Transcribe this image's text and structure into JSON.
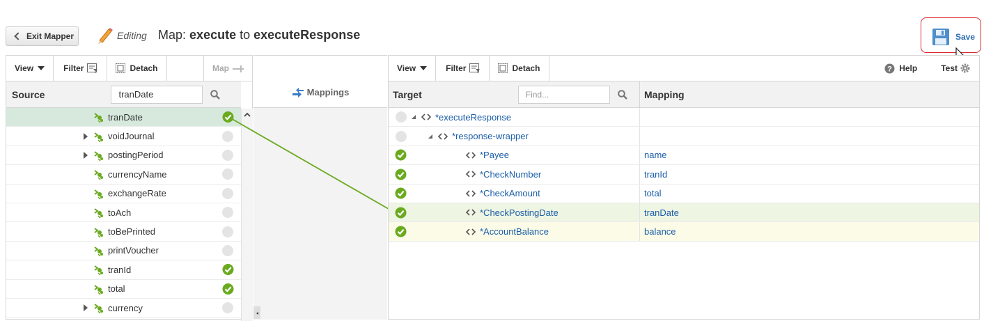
{
  "header": {
    "exit_label": "Exit Mapper",
    "editing_label": "Editing",
    "map_prefix": "Map:",
    "map_source": "execute",
    "map_to": "to",
    "map_target": "executeResponse",
    "save_label": "Save"
  },
  "source_panel": {
    "toolbar": {
      "view": "View",
      "filter": "Filter",
      "detach": "Detach",
      "map": "Map"
    },
    "header_title": "Source",
    "search_value": "tranDate",
    "rows": [
      {
        "label": "tranDate",
        "expandable": false,
        "mapped": true,
        "selected": true
      },
      {
        "label": "voidJournal",
        "expandable": true,
        "mapped": false,
        "selected": false
      },
      {
        "label": "postingPeriod",
        "expandable": true,
        "mapped": false,
        "selected": false
      },
      {
        "label": "currencyName",
        "expandable": false,
        "mapped": false,
        "selected": false
      },
      {
        "label": "exchangeRate",
        "expandable": false,
        "mapped": false,
        "selected": false
      },
      {
        "label": "toAch",
        "expandable": false,
        "mapped": false,
        "selected": false
      },
      {
        "label": "toBePrinted",
        "expandable": false,
        "mapped": false,
        "selected": false
      },
      {
        "label": "printVoucher",
        "expandable": false,
        "mapped": false,
        "selected": false
      },
      {
        "label": "tranId",
        "expandable": false,
        "mapped": true,
        "selected": false
      },
      {
        "label": "total",
        "expandable": false,
        "mapped": true,
        "selected": false
      },
      {
        "label": "currency",
        "expandable": true,
        "mapped": false,
        "selected": false
      }
    ]
  },
  "mappings_panel": {
    "title": "Mappings"
  },
  "target_panel": {
    "toolbar": {
      "view": "View",
      "filter": "Filter",
      "detach": "Detach",
      "help": "Help",
      "test": "Test"
    },
    "header_title": "Target",
    "search_placeholder": "Find...",
    "mapping_header": "Mapping",
    "rows": [
      {
        "label": "*executeResponse",
        "mapping": "",
        "mapped": false,
        "level": 0,
        "collapsible": true,
        "highlight": ""
      },
      {
        "label": "*response-wrapper",
        "mapping": "",
        "mapped": false,
        "level": 1,
        "collapsible": true,
        "highlight": ""
      },
      {
        "label": "*Payee",
        "mapping": "name",
        "mapped": true,
        "level": 2,
        "collapsible": false,
        "highlight": ""
      },
      {
        "label": "*CheckNumber",
        "mapping": "tranId",
        "mapped": true,
        "level": 2,
        "collapsible": false,
        "highlight": ""
      },
      {
        "label": "*CheckAmount",
        "mapping": "total",
        "mapped": true,
        "level": 2,
        "collapsible": false,
        "highlight": ""
      },
      {
        "label": "*CheckPostingDate",
        "mapping": "tranDate",
        "mapped": true,
        "level": 2,
        "collapsible": false,
        "highlight": "green"
      },
      {
        "label": "*AccountBalance",
        "mapping": "balance",
        "mapped": true,
        "level": 2,
        "collapsible": false,
        "highlight": "yellow"
      }
    ]
  },
  "colors": {
    "check_green": "#6aaa1f",
    "link_blue": "#1b5ea8",
    "selected_row": "#d7e9dd",
    "highlight_green": "#eef5e3",
    "highlight_yellow": "#fbfbe8",
    "save_outline": "#d9262b",
    "connector_line": "#6aaa1f"
  },
  "icons": {
    "source_node": "xml-element-icon",
    "target_node": "angle-brackets-icon",
    "mapped": "green-check-icon",
    "save": "floppy-disk-icon"
  }
}
